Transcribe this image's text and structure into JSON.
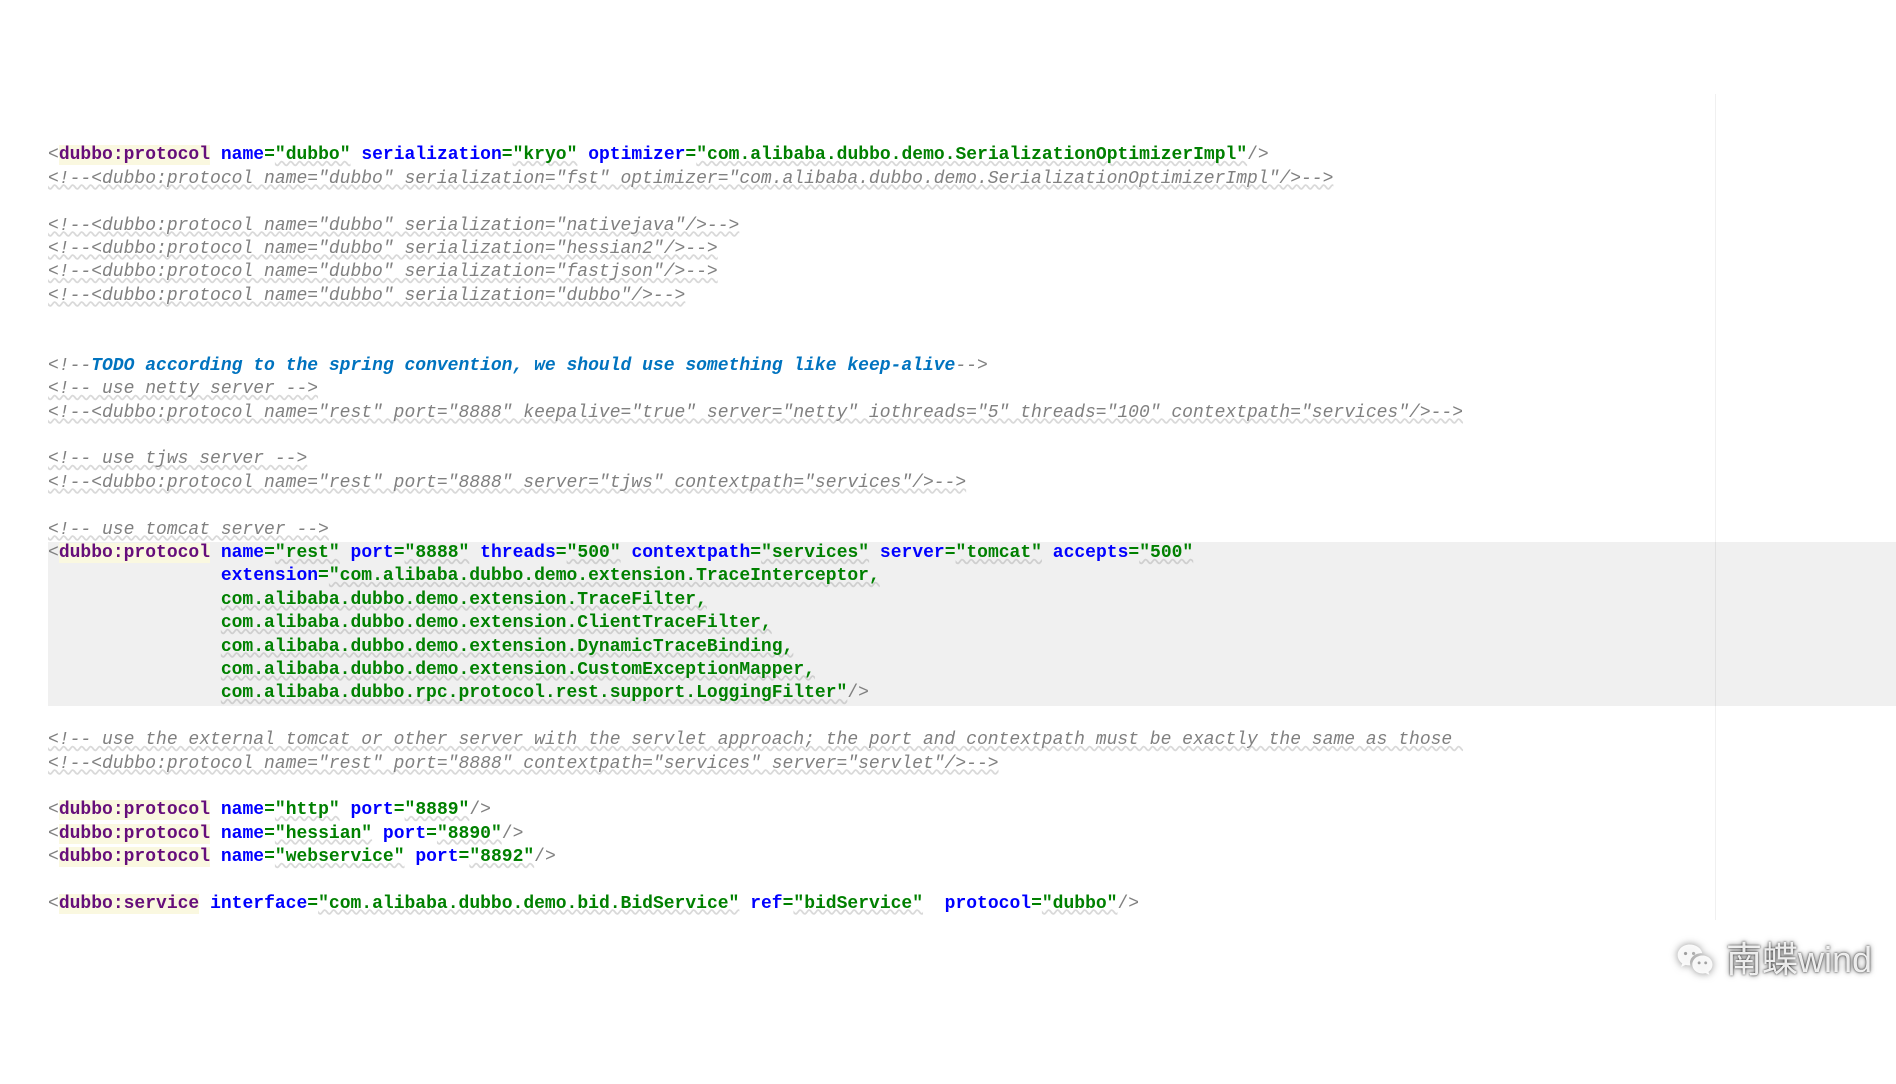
{
  "code": {
    "lines": [
      {
        "type": "xml",
        "raw": "<dubbo:protocol name=\"dubbo\" serialization=\"kryo\" optimizer=\"com.alibaba.dubbo.demo.SerializationOptimizerImpl\"/>",
        "hlTag": true
      },
      {
        "type": "comment",
        "raw": "<!--<dubbo:protocol name=\"dubbo\" serialization=\"fst\" optimizer=\"com.alibaba.dubbo.demo.SerializationOptimizerImpl\"/>-->"
      },
      {
        "type": "blank"
      },
      {
        "type": "comment",
        "raw": "<!--<dubbo:protocol name=\"dubbo\" serialization=\"nativejava\"/>-->"
      },
      {
        "type": "comment",
        "raw": "<!--<dubbo:protocol name=\"dubbo\" serialization=\"hessian2\"/>-->"
      },
      {
        "type": "comment",
        "raw": "<!--<dubbo:protocol name=\"dubbo\" serialization=\"fastjson\"/>-->"
      },
      {
        "type": "comment",
        "raw": "<!--<dubbo:protocol name=\"dubbo\" serialization=\"dubbo\"/>-->"
      },
      {
        "type": "blank"
      },
      {
        "type": "blank"
      },
      {
        "type": "comment-todo",
        "prefix": "<!--",
        "todo": "TODO according to the spring convention, we should use something like keep-alive",
        "suffix": "-->"
      },
      {
        "type": "comment",
        "raw": "<!-- use netty server -->"
      },
      {
        "type": "comment",
        "raw": "<!--<dubbo:protocol name=\"rest\" port=\"8888\" keepalive=\"true\" server=\"netty\" iothreads=\"5\" threads=\"100\" contextpath=\"services\"/>-->"
      },
      {
        "type": "blank"
      },
      {
        "type": "comment",
        "raw": "<!-- use tjws server -->"
      },
      {
        "type": "comment",
        "raw": "<!--<dubbo:protocol name=\"rest\" port=\"8888\" server=\"tjws\" contextpath=\"services\"/>-->"
      },
      {
        "type": "blank"
      },
      {
        "type": "comment",
        "raw": "<!-- use tomcat server -->"
      },
      {
        "type": "xml-open",
        "raw": "<dubbo:protocol name=\"rest\" port=\"8888\" threads=\"500\" contextpath=\"services\" server=\"tomcat\" accepts=\"500\"",
        "hlTag": true,
        "hlBlock": true
      },
      {
        "type": "xml-cont",
        "indent": "                ",
        "attr": "extension",
        "val": "\"com.alibaba.dubbo.demo.extension.TraceInterceptor,",
        "hlBlock": true
      },
      {
        "type": "val-cont",
        "indent": "                ",
        "val": "com.alibaba.dubbo.demo.extension.TraceFilter,",
        "hlBlock": true
      },
      {
        "type": "val-cont",
        "indent": "                ",
        "val": "com.alibaba.dubbo.demo.extension.ClientTraceFilter,",
        "hlBlock": true
      },
      {
        "type": "val-cont",
        "indent": "                ",
        "val": "com.alibaba.dubbo.demo.extension.DynamicTraceBinding,",
        "hlBlock": true
      },
      {
        "type": "val-cont",
        "indent": "                ",
        "val": "com.alibaba.dubbo.demo.extension.CustomExceptionMapper,",
        "hlBlock": true
      },
      {
        "type": "val-close",
        "indent": "                ",
        "val": "com.alibaba.dubbo.rpc.protocol.rest.support.LoggingFilter\"",
        "close": "/>",
        "hlBlock": true
      },
      {
        "type": "blank"
      },
      {
        "type": "comment",
        "raw": "<!-- use the external tomcat or other server with the servlet approach; the port and contextpath must be exactly the same as those "
      },
      {
        "type": "comment",
        "raw": "<!--<dubbo:protocol name=\"rest\" port=\"8888\" contextpath=\"services\" server=\"servlet\"/>-->"
      },
      {
        "type": "blank"
      },
      {
        "type": "xml",
        "raw": "<dubbo:protocol name=\"http\" port=\"8889\"/>",
        "hlTag": true
      },
      {
        "type": "xml",
        "raw": "<dubbo:protocol name=\"hessian\" port=\"8890\"/>",
        "hlTag": true
      },
      {
        "type": "xml",
        "raw": "<dubbo:protocol name=\"webservice\" port=\"8892\"/>",
        "hlTag": true
      },
      {
        "type": "blank"
      },
      {
        "type": "xml",
        "raw": "<dubbo:service interface=\"com.alibaba.dubbo.demo.bid.BidService\" ref=\"bidService\"  protocol=\"dubbo\"/>",
        "hlTag": true
      }
    ]
  },
  "watermark": "南蝶wind"
}
